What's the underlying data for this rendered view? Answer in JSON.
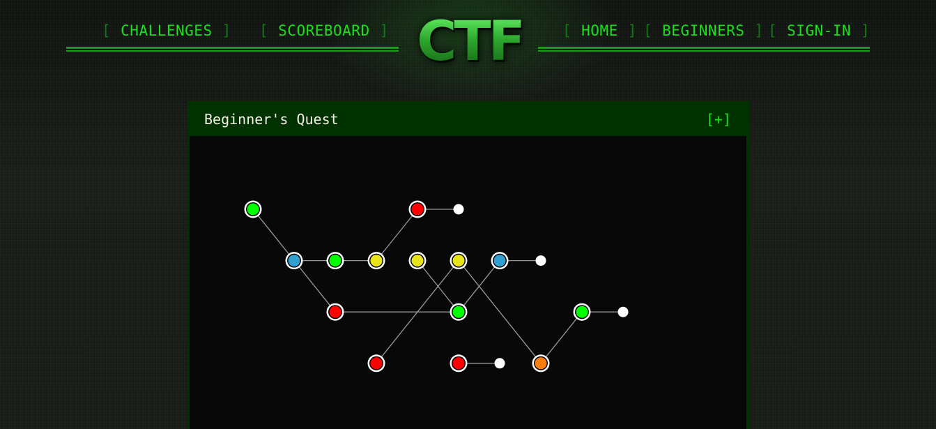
{
  "nav": {
    "left": [
      {
        "label": "CHALLENGES"
      },
      {
        "label": "SCOREBOARD"
      }
    ],
    "logo": "CTF",
    "right": [
      {
        "label": "HOME"
      },
      {
        "label": "BEGINNERS"
      },
      {
        "label": "SIGN-IN"
      }
    ],
    "bracket_open": "[",
    "bracket_close": "]"
  },
  "panel": {
    "title": "Beginner's Quest",
    "toggle_label": "[+]"
  },
  "status_colors": {
    "green": "#00ff00",
    "red": "#ff0000",
    "yellow": "#e8e41a",
    "blue": "#2fa0d0",
    "orange": "#ff7f0e",
    "end": "#ffffff"
  },
  "quest_map": {
    "nodes": [
      {
        "id": "n1",
        "col": 0,
        "row": 0,
        "status": "green"
      },
      {
        "id": "n2",
        "col": 1,
        "row": 1,
        "status": "blue"
      },
      {
        "id": "n3",
        "col": 2,
        "row": 1,
        "status": "green"
      },
      {
        "id": "n4",
        "col": 3,
        "row": 1,
        "status": "yellow"
      },
      {
        "id": "n5",
        "col": 4,
        "row": 0,
        "status": "red"
      },
      {
        "id": "e1",
        "col": 5,
        "row": 0,
        "status": "end"
      },
      {
        "id": "n6",
        "col": 2,
        "row": 2,
        "status": "red"
      },
      {
        "id": "n7",
        "col": 4,
        "row": 1,
        "status": "yellow"
      },
      {
        "id": "n8",
        "col": 5,
        "row": 1,
        "status": "yellow"
      },
      {
        "id": "n9",
        "col": 5,
        "row": 2,
        "status": "green"
      },
      {
        "id": "n10",
        "col": 6,
        "row": 1,
        "status": "blue"
      },
      {
        "id": "e2",
        "col": 7,
        "row": 1,
        "status": "end"
      },
      {
        "id": "n11",
        "col": 3,
        "row": 3,
        "status": "red"
      },
      {
        "id": "n12",
        "col": 5,
        "row": 3,
        "status": "red"
      },
      {
        "id": "e3",
        "col": 6,
        "row": 3,
        "status": "end"
      },
      {
        "id": "n13",
        "col": 7,
        "row": 3,
        "status": "orange"
      },
      {
        "id": "n14",
        "col": 8,
        "row": 2,
        "status": "green"
      },
      {
        "id": "e4",
        "col": 9,
        "row": 2,
        "status": "end"
      }
    ],
    "edges": [
      [
        "n1",
        "n2"
      ],
      [
        "n2",
        "n3"
      ],
      [
        "n3",
        "n4"
      ],
      [
        "n4",
        "n5"
      ],
      [
        "n5",
        "e1"
      ],
      [
        "n2",
        "n6"
      ],
      [
        "n6",
        "n9"
      ],
      [
        "n7",
        "n9"
      ],
      [
        "n9",
        "n10"
      ],
      [
        "n10",
        "e2"
      ],
      [
        "n8",
        "n11"
      ],
      [
        "n8",
        "n13"
      ],
      [
        "n13",
        "n14"
      ],
      [
        "n14",
        "e4"
      ],
      [
        "n12",
        "e3"
      ]
    ]
  }
}
